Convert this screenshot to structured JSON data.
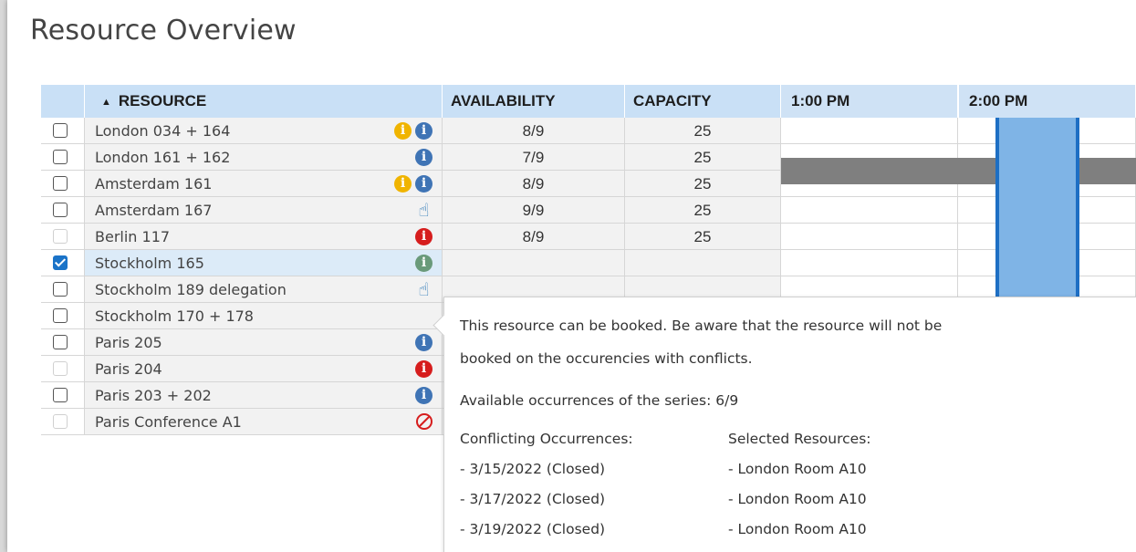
{
  "title": "Resource Overview",
  "columns": {
    "resource": "RESOURCE",
    "sort_indicator": "▲",
    "availability": "AVAILABILITY",
    "capacity": "CAPACITY",
    "time1": "1:00 PM",
    "time2": "2:00 PM"
  },
  "rows": [
    {
      "name": "London 034 + 164",
      "availability": "8/9",
      "capacity": "25",
      "checkbox": "unchecked",
      "icons": [
        "warning-info-icon",
        "info-icon"
      ]
    },
    {
      "name": "London 161 + 162",
      "availability": "7/9",
      "capacity": "25",
      "checkbox": "unchecked",
      "icons": [
        "info-icon"
      ]
    },
    {
      "name": "Amsterdam 161",
      "availability": "8/9",
      "capacity": "25",
      "checkbox": "unchecked",
      "icons": [
        "warning-info-icon",
        "info-icon"
      ]
    },
    {
      "name": "Amsterdam 167",
      "availability": "9/9",
      "capacity": "25",
      "checkbox": "unchecked",
      "icons": [
        "hand-icon"
      ]
    },
    {
      "name": "Berlin 117",
      "availability": "8/9",
      "capacity": "25",
      "checkbox": "disabled",
      "icons": [
        "error-info-icon"
      ]
    },
    {
      "name": "Stockholm 165",
      "availability": "",
      "capacity": "",
      "checkbox": "checked",
      "icons": [
        "available-info-icon"
      ]
    },
    {
      "name": "Stockholm 189 delegation",
      "availability": "",
      "capacity": "",
      "checkbox": "unchecked",
      "icons": [
        "hand-icon"
      ]
    },
    {
      "name": "Stockholm 170 + 178",
      "availability": "",
      "capacity": "",
      "checkbox": "unchecked",
      "icons": []
    },
    {
      "name": "Paris 205",
      "availability": "",
      "capacity": "",
      "checkbox": "unchecked",
      "icons": [
        "info-icon"
      ]
    },
    {
      "name": "Paris 204",
      "availability": "",
      "capacity": "",
      "checkbox": "disabled",
      "icons": [
        "error-info-icon"
      ]
    },
    {
      "name": "Paris 203 + 202",
      "availability": "",
      "capacity": "",
      "checkbox": "unchecked",
      "icons": [
        "info-icon"
      ]
    },
    {
      "name": "Paris Conference A1",
      "availability": "",
      "capacity": "",
      "checkbox": "disabled",
      "icons": [
        "blocked-icon"
      ]
    }
  ],
  "tooltip": {
    "line1": "This resource can be booked. Be aware that the resource will not be",
    "line2": "booked on the occurencies with conflicts.",
    "available": "Available occurrences of the series: 6/9",
    "conflicting_header": "Conflicting Occurrences:",
    "selected_header": "Selected Resources:",
    "conflicts": [
      "- 3/15/2022 (Closed)",
      "- 3/17/2022 (Closed)",
      "- 3/19/2022 (Closed)"
    ],
    "selected": [
      "- London Room A10",
      "- London Room A10",
      "- London Room A10"
    ]
  },
  "icon_glyphs": {
    "info": "i",
    "hand": "☝"
  },
  "colors": {
    "header_bg": "#c9e0f6",
    "selected_slot": "#7fb4e6",
    "slot_border": "#1e6fc4",
    "busy": "#7f7f7f",
    "error": "#d61d1d",
    "warning": "#f0b400",
    "info": "#3f74b5"
  }
}
